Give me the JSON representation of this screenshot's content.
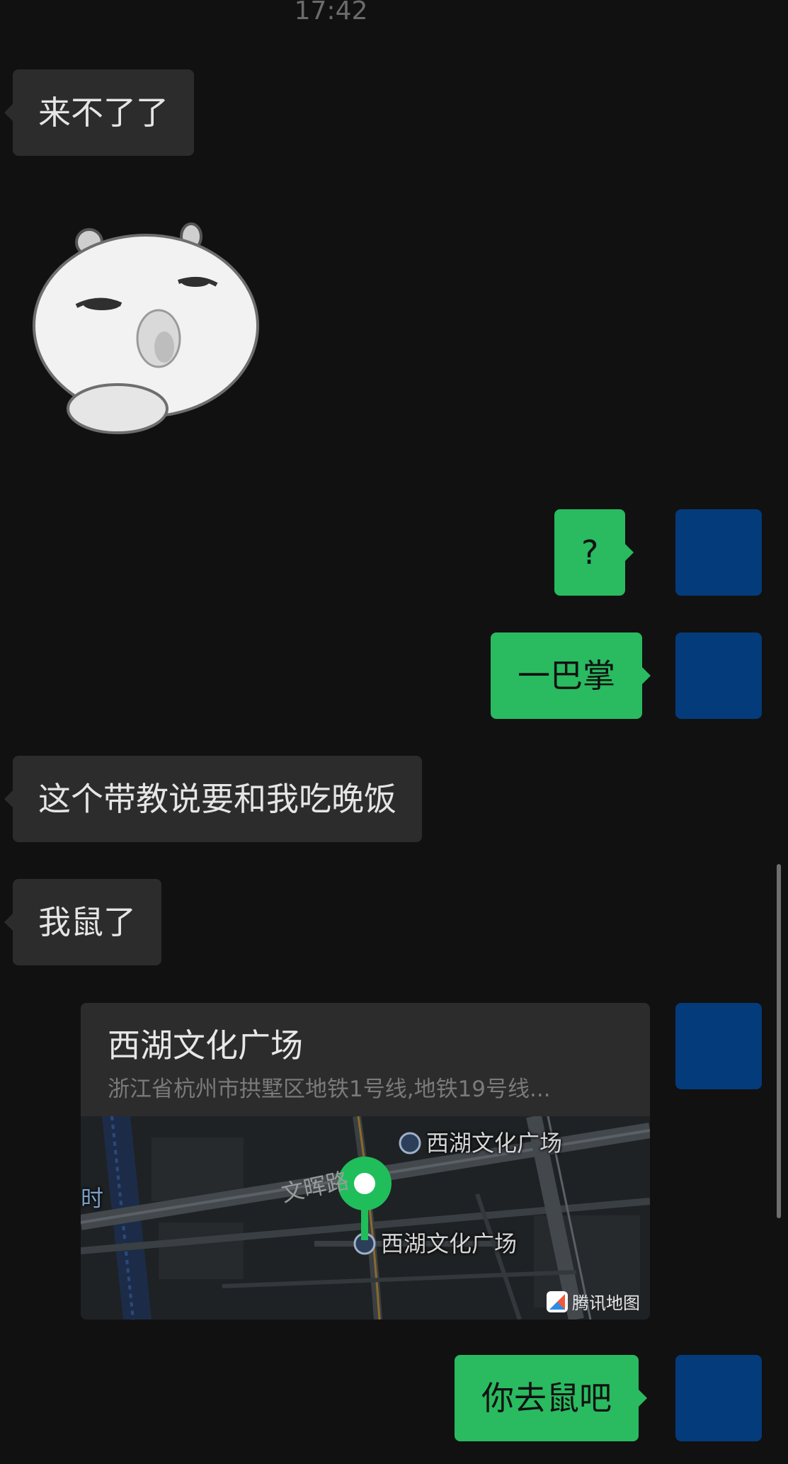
{
  "chat": {
    "timestamp": "17:42",
    "messages": [
      {
        "side": "left",
        "type": "text",
        "text": "来不了了"
      },
      {
        "side": "left",
        "type": "sticker",
        "icon": "white-mouse-face-sticker"
      },
      {
        "side": "right",
        "type": "text",
        "text": "?"
      },
      {
        "side": "right",
        "type": "text",
        "text": "一巴掌"
      },
      {
        "side": "left",
        "type": "text",
        "text": "这个带教说要和我吃晚饭"
      },
      {
        "side": "left",
        "type": "text",
        "text": "我鼠了"
      },
      {
        "side": "right",
        "type": "location"
      },
      {
        "side": "right",
        "type": "text",
        "text": "你去鼠吧"
      }
    ]
  },
  "location": {
    "title": "西湖文化广场",
    "address": "浙江省杭州市拱墅区地铁1号线,地铁19号线...",
    "map": {
      "road_label": "文晖路",
      "station_label_top": "西湖文化广场",
      "station_label_bottom": "西湖文化广场",
      "edge_label": "时",
      "provider": "腾讯地图",
      "pin_color": "#1fbe5b"
    }
  },
  "colors": {
    "background": "#111111",
    "incoming_bubble": "#2c2c2c",
    "outgoing_bubble": "#2aba60",
    "avatar": "#043b7b"
  }
}
